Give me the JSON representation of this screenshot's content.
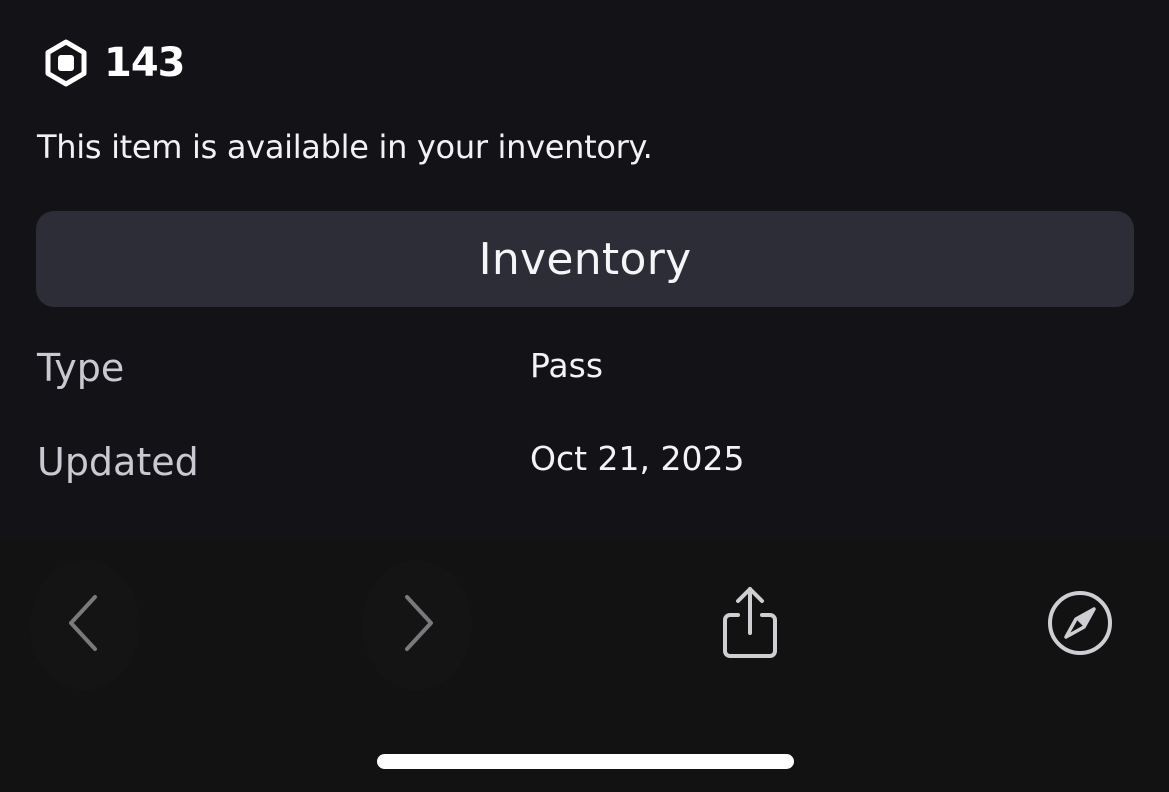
{
  "price": {
    "currency_icon": "robux-icon",
    "value": "143"
  },
  "availability_text": "This item is available in your inventory.",
  "primary_button": {
    "label": "Inventory"
  },
  "details": [
    {
      "label": "Type",
      "value": "Pass"
    },
    {
      "label": "Updated",
      "value": "Oct 21, 2025"
    }
  ],
  "toolbar": {
    "icons": [
      "chevron-left-icon",
      "chevron-right-icon",
      "share-icon",
      "compass-icon"
    ]
  },
  "colors": {
    "background": "#131317",
    "button_background": "#2c2d36",
    "text_primary": "#f2f2f4",
    "text_label": "#c9cad1",
    "toolbar_background": "#121212"
  }
}
